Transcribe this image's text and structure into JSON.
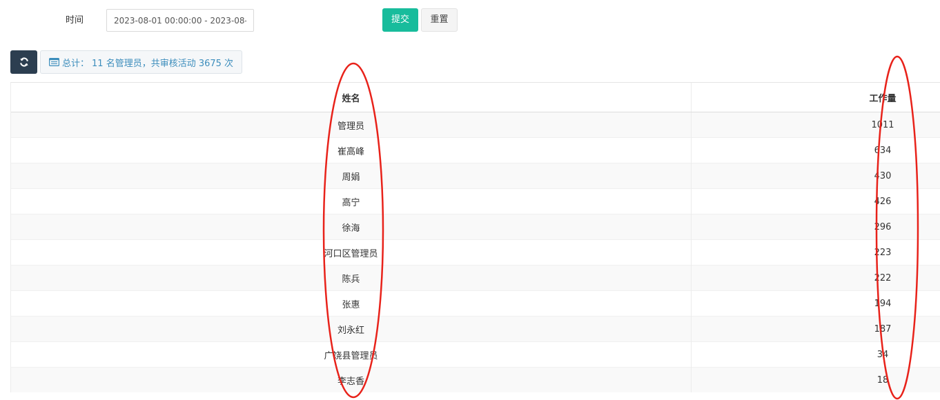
{
  "filter": {
    "time_label": "时间",
    "time_value": "2023-08-01 00:00:00 - 2023-08-0"
  },
  "buttons": {
    "submit_label": "提交",
    "reset_label": "重置"
  },
  "toolbar": {
    "refresh_icon": "refresh-icon",
    "summary_icon": "list-icon",
    "summary_prefix": "总计：",
    "summary_admins": "11 名管理员，共审核活动 3675 次"
  },
  "table": {
    "headers": [
      "姓名",
      "工作量"
    ],
    "rows": [
      {
        "name": "管理员",
        "count": "1011"
      },
      {
        "name": "崔高峰",
        "count": "634"
      },
      {
        "name": "周娟",
        "count": "430"
      },
      {
        "name": "高宁",
        "count": "426"
      },
      {
        "name": "徐海",
        "count": "296"
      },
      {
        "name": "河口区管理员",
        "count": "223"
      },
      {
        "name": "陈兵",
        "count": "222"
      },
      {
        "name": "张惠",
        "count": "194"
      },
      {
        "name": "刘永红",
        "count": "187"
      },
      {
        "name": "广饶县管理员",
        "count": "34"
      },
      {
        "name": "李志香",
        "count": "18"
      }
    ]
  },
  "colors": {
    "submit": "#18bc9c",
    "refresh": "#2c3e50",
    "summary_text": "#3c8dbc",
    "annotation": "#e8221a"
  }
}
